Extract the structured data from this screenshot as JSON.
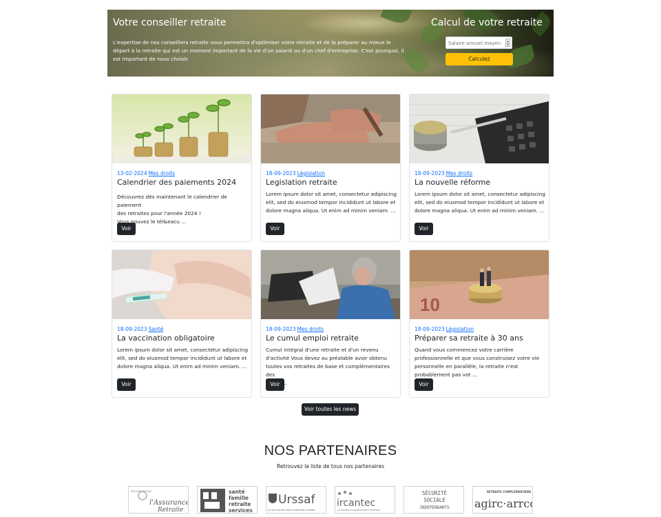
{
  "hero": {
    "title": "Votre conseiller retraite",
    "text": "L'expertise de nos conseillers retraite vous permettra d'optimiser votre retraite et de la préparer au mieux le départ à la retraite qui est un moment important de la vie d'un salarié ou d'un chef d'entreprise. C'est pourquoi, il est important de nous choisir.",
    "calc_title": "Calcul de votre retraite",
    "salary_placeholder": "Salaire annuel moyen",
    "calc_button": "Calculez"
  },
  "cards": [
    {
      "date": "13-02-2024",
      "category": "Mes droits",
      "title": "Calendrier des paiements 2024",
      "excerpt_lines": [
        "Découvrez dès maintenant le calendrier de paiement",
        "des retraites pour l'année 2024 !",
        "Vous pouvez le tél&eacu ..."
      ],
      "button": "Voir",
      "image": "coins-plants-image"
    },
    {
      "date": "18-09-2023",
      "category": "Législation",
      "title": "Legislation retraite",
      "excerpt_lines": [
        "Lorem ipsum dolor sit amet, consectetur adipiscing",
        "elit, sed do eiusmod tempor incididunt ut labore et",
        "dolore magna aliqua. Ut enim ad minim veniam. ..."
      ],
      "button": "Voir",
      "image": "elderly-hands-image"
    },
    {
      "date": "18-09-2023",
      "category": "Mes droits",
      "title": "La nouvelle réforme",
      "excerpt_lines": [
        "Lorem ipsum dolor sit amet, consectetur adipiscing",
        "elit, sed do eiusmod tempor incididunt ut labore et",
        "dolore magna aliqua. Ut enim ad minim veniam. ..."
      ],
      "button": "Voir",
      "image": "calculator-coins-image"
    },
    {
      "date": "18-09-2023",
      "category": "Santé",
      "title": "La vaccination obligatoire",
      "excerpt_lines": [
        "Lorem ipsum dolor sit amet, consectetur adipiscing",
        "elit, sed do eiusmod tempor incididunt ut labore et",
        "dolore magna aliqua. Ut enim ad minim veniam. ..."
      ],
      "button": "Voir",
      "image": "vaccination-image"
    },
    {
      "date": "18-09-2023",
      "category": "Mes droits",
      "title": "Le cumul emploi retraite",
      "excerpt_lines": [
        "Cumul intégral d'une retraite et d'un revenu",
        "d'activité Vous devez au préalable avoir obtenu",
        "toutes vos retraites de base et complémentaires des",
        "régim ..."
      ],
      "button": "Voir",
      "image": "woman-laptop-image"
    },
    {
      "date": "18-09-2023",
      "category": "Législation",
      "title": "Préparer sa retraite à 30 ans",
      "excerpt_lines": [
        "Quand vous commencez votre carrière",
        "professionnelle et que vous construisez votre vie",
        "personnelle en parallèle, la retraite n'est",
        "probablement pas vot ..."
      ],
      "button": "Voir",
      "image": "couple-coins-image"
    }
  ],
  "all_news_button": "Voir toutes les news",
  "partners": {
    "title": "NOS PARTENAIRES",
    "subtitle": "Retrouvez la liste de tous nos partenaires",
    "logos": [
      {
        "name": "assurance-retraite-logo",
        "line1": "l'Assurance",
        "line2": "Retraite",
        "small": "SÉCURITÉ SOCIALE"
      },
      {
        "name": "msa-logo",
        "line1": "santé",
        "line2": "famille",
        "line3": "retraite",
        "line4": "services"
      },
      {
        "name": "urssaf-logo",
        "line1": "Urssaf",
        "small": "Au service de notre protection sociale"
      },
      {
        "name": "ircantec-logo",
        "line1": "ircantec",
        "small": "La retraite complémentaire publique"
      },
      {
        "name": "securite-sociale-independants-logo",
        "line1": "SÉCURITÉ",
        "line2": "SOCIALE",
        "line3": "INDÉPENDANTS"
      },
      {
        "name": "agirc-arrco-logo",
        "line1": "agirc·arrco",
        "small": "RETRAITE COMPLÉMENTAIRE"
      }
    ]
  }
}
